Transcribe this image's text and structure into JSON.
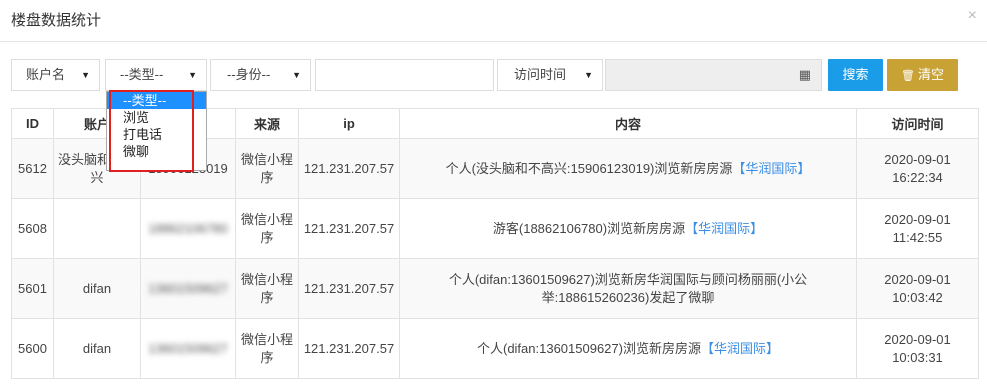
{
  "dialog": {
    "title": "楼盘数据统计",
    "close_symbol": "×"
  },
  "filters": {
    "account": {
      "value": "账户名",
      "caret": "▼"
    },
    "type": {
      "value": "--类型--",
      "caret": "▼",
      "options": [
        "--类型--",
        "浏览",
        "打电话",
        "微聊"
      ]
    },
    "role": {
      "value": "--身份--",
      "caret": "▼"
    },
    "keyword": {
      "value": ""
    },
    "time_field": {
      "value": "访问时间",
      "caret": "▼"
    },
    "date_range": {
      "value": "",
      "icon": "calendar-icon",
      "icon_glyph": "▦"
    }
  },
  "buttons": {
    "search_label": "搜索",
    "clear_label": "清空",
    "clear_icon": "trash-icon",
    "clear_glyph": "🗑"
  },
  "table": {
    "headers": [
      "ID",
      "账户",
      "",
      "来源",
      "ip",
      "内容",
      "访问时间"
    ],
    "rows": [
      {
        "id": "5612",
        "account": "没头脑和不高兴",
        "phone": "15906123019",
        "source": "微信小程序",
        "ip": "121.231.207.57",
        "content": "个人(没头脑和不高兴:15906123019)浏览新房房源",
        "tag": "【华润国际】",
        "date": "2020-09-01",
        "time": "16:22:34"
      },
      {
        "id": "5608",
        "account": "",
        "phone": "18862106780",
        "source": "微信小程序",
        "ip": "121.231.207.57",
        "content": "游客(18862106780)浏览新房房源",
        "tag": "【华润国际】",
        "date": "2020-09-01",
        "time": "11:42:55"
      },
      {
        "id": "5601",
        "account": "difan",
        "phone": "13601509627",
        "source": "微信小程序",
        "ip": "121.231.207.57",
        "content": "个人(difan:13601509627)浏览新房华润国际与顾问杨丽丽(小公举:188615260236)发起了微聊",
        "tag": "",
        "date": "2020-09-01",
        "time": "10:03:42"
      },
      {
        "id": "5600",
        "account": "difan",
        "phone": "13601509627",
        "source": "微信小程序",
        "ip": "121.231.207.57",
        "content": "个人(difan:13601509627)浏览新房房源",
        "tag": "【华润国际】",
        "date": "2020-09-01",
        "time": "10:03:31"
      }
    ]
  },
  "colors": {
    "search": "#1a9ce8",
    "clear": "#c9a236",
    "highlight": "#e02020",
    "selected": "#1e90ff",
    "link": "#3a8ee6"
  }
}
